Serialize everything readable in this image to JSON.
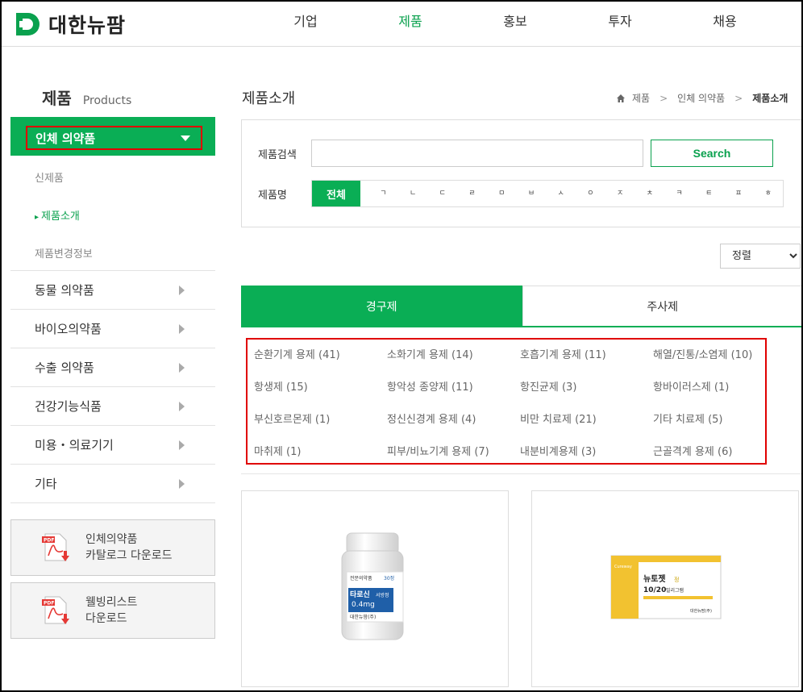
{
  "header": {
    "logo_text": "대한뉴팜",
    "nav": [
      "기업",
      "제품",
      "홍보",
      "투자",
      "채용"
    ],
    "active_nav": "제품"
  },
  "sidebar": {
    "title": "제품",
    "title_en": "Products",
    "active_category": "인체 의약품",
    "sub_items": [
      {
        "label": "신제품",
        "current": false
      },
      {
        "label": "제품소개",
        "current": true
      },
      {
        "label": "제품변경정보",
        "current": false
      }
    ],
    "categories": [
      "동물 의약품",
      "바이오의약품",
      "수출 의약품",
      "건강기능식품",
      "미용・의료기기",
      "기타"
    ],
    "downloads": [
      {
        "line1": "인체의약품",
        "line2": "카탈로그 다운로드"
      },
      {
        "line1": "웰빙리스트",
        "line2": "다운로드"
      }
    ]
  },
  "main": {
    "title": "제품소개",
    "breadcrumb": [
      "제품",
      "인체 의약품",
      "제품소개"
    ]
  },
  "search": {
    "label": "제품검색",
    "value": "",
    "placeholder": "",
    "button": "Search",
    "name_label": "제품명",
    "all": "전체",
    "letters": [
      "ㄱ",
      "ㄴ",
      "ㄷ",
      "ㄹ",
      "ㅁ",
      "ㅂ",
      "ㅅ",
      "ㅇ",
      "ㅈ",
      "ㅊ",
      "ㅋ",
      "ㅌ",
      "ㅍ",
      "ㅎ"
    ]
  },
  "sort": {
    "selected": "정렬"
  },
  "tabs": [
    {
      "label": "경구제",
      "active": true
    },
    {
      "label": "주사제",
      "active": false
    }
  ],
  "categories": [
    "순환기계 용제 (41)",
    "소화기계 용제 (14)",
    "호흡기계 용제 (11)",
    "해열/진통/소염제 (10)",
    "항생제 (15)",
    "항악성 종양제 (11)",
    "항진균제 (3)",
    "항바이러스제 (1)",
    "부신호르몬제 (1)",
    "정신신경계 용제 (4)",
    "비만 치료제 (21)",
    "기타 치료제 (5)",
    "마취제 (1)",
    "피부/비뇨기계 용제 (7)",
    "내분비계용제 (3)",
    "근골격계 용제 (6)"
  ],
  "products": [
    {
      "label_small": "전문의약품",
      "count": "30정",
      "name": "타로신",
      "tag": "서방정",
      "dose": "0.4mg",
      "maker": "대한뉴팜(주)"
    },
    {
      "brand": "Cureway",
      "name": "뉴토젯",
      "tag": "정",
      "dose": "10/20",
      "unit": "밀리그램",
      "maker": "대한뉴팜(주)"
    }
  ],
  "colors": {
    "brand_green": "#0aae55",
    "highlight_red": "#e00000"
  }
}
